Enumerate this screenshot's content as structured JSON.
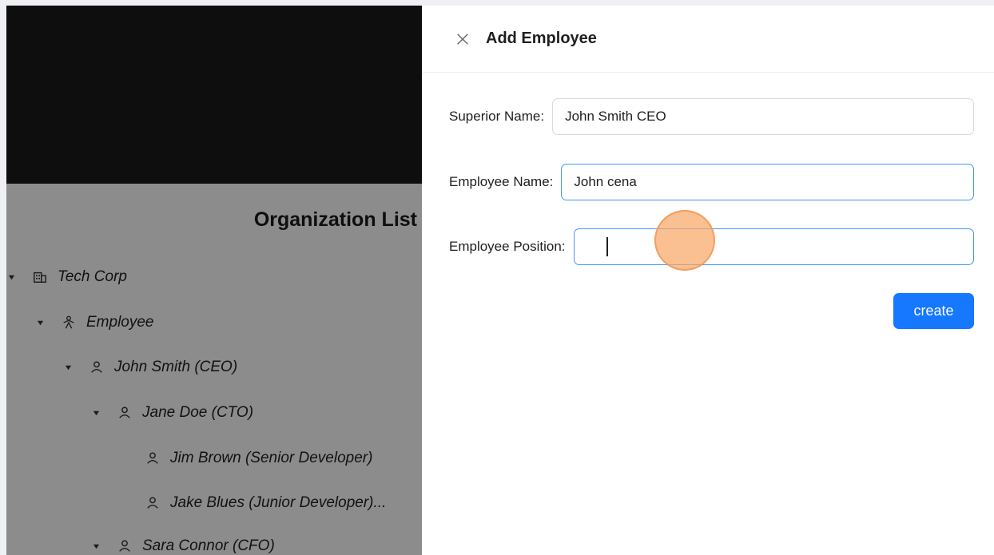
{
  "org_list": {
    "title": "Organization List",
    "nodes": [
      {
        "label": "Tech Corp",
        "icon": "building-icon",
        "expanded": true
      },
      {
        "label": "Employee",
        "icon": "employee-group-icon",
        "expanded": true
      },
      {
        "label": "John Smith (CEO)",
        "icon": "user-icon",
        "expanded": true
      },
      {
        "label": "Jane Doe (CTO)",
        "icon": "user-icon",
        "expanded": true
      },
      {
        "label": "Jim Brown (Senior Developer)",
        "icon": "user-icon",
        "expanded": false
      },
      {
        "label": "Jake Blues (Junior Developer)...",
        "icon": "user-icon",
        "expanded": false
      },
      {
        "label": "Sara Connor (CFO)",
        "icon": "user-icon",
        "expanded": true
      }
    ]
  },
  "drawer": {
    "title": "Add Employee",
    "fields": {
      "superior_label": "Superior Name:",
      "superior_value": "John Smith CEO",
      "employee_name_label": "Employee Name:",
      "employee_name_value": "John cena",
      "employee_position_label": "Employee Position:",
      "employee_position_value": ""
    },
    "create_label": "create"
  },
  "colors": {
    "primary": "#1677ff",
    "focus_border": "#4096ff",
    "header_dark": "#1a1a1a",
    "click_marker": "#f8a564"
  }
}
